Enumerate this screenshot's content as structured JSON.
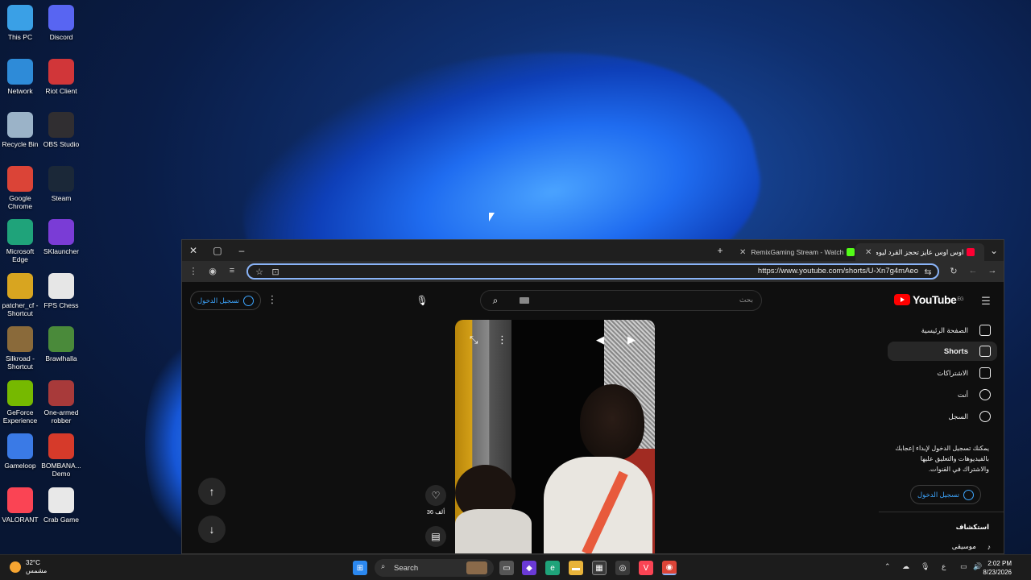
{
  "desktop": {
    "icons": [
      {
        "label": "This PC",
        "icon": "monitor-icon",
        "color": "#3aa0e6"
      },
      {
        "label": "Discord",
        "icon": "discord-icon",
        "color": "#5865f2"
      },
      {
        "label": "Network",
        "icon": "network-icon",
        "color": "#2e8bd8"
      },
      {
        "label": "Riot Client",
        "icon": "riot-icon",
        "color": "#d13639"
      },
      {
        "label": "Recycle Bin",
        "icon": "recycle-bin-icon",
        "color": "#9bb3c8"
      },
      {
        "label": "OBS Studio",
        "icon": "obs-icon",
        "color": "#302e31"
      },
      {
        "label": "Google Chrome",
        "icon": "chrome-icon",
        "color": "#db4437"
      },
      {
        "label": "Steam",
        "icon": "steam-icon",
        "color": "#1b2838"
      },
      {
        "label": "Microsoft Edge",
        "icon": "edge-icon",
        "color": "#1fa37a"
      },
      {
        "label": "SKlauncher",
        "icon": "sklauncher-icon",
        "color": "#7a3cd6"
      },
      {
        "label": "patcher_cf - Shortcut",
        "icon": "patcher-icon",
        "color": "#d8a520"
      },
      {
        "label": "FPS Chess",
        "icon": "chess-icon",
        "color": "#e6e6e6"
      },
      {
        "label": "Silkroad - Shortcut",
        "icon": "silkroad-icon",
        "color": "#8a6a3a"
      },
      {
        "label": "Brawlhalla",
        "icon": "brawlhalla-icon",
        "color": "#4a8a3a"
      },
      {
        "label": "GeForce Experience",
        "icon": "geforce-icon",
        "color": "#76b900"
      },
      {
        "label": "One-armed robber",
        "icon": "robber-icon",
        "color": "#a83a3a"
      },
      {
        "label": "Gameloop",
        "icon": "gameloop-icon",
        "color": "#3a7ae6"
      },
      {
        "label": "BOMBANA... Demo",
        "icon": "bombana-icon",
        "color": "#d63a2a"
      },
      {
        "label": "VALORANT",
        "icon": "valorant-icon",
        "color": "#fa4454"
      },
      {
        "label": "Crab Game",
        "icon": "crab-game-icon",
        "color": "#e8e8e8"
      }
    ]
  },
  "browser": {
    "tabs": [
      {
        "title": "RemixGaming Stream - Watch",
        "favicon_color": "#53fc18"
      },
      {
        "title": "اوس اوس عايز تحجز القرد ليومين",
        "favicon_color": "#ff0033"
      }
    ],
    "url": "https://www.youtube.com/shorts/U-Xn7g4mAeo"
  },
  "youtube": {
    "logo_text": "YouTube",
    "logo_region": "EG",
    "search_placeholder": "بحث",
    "signin_label": "تسجيل الدخول",
    "nav": [
      {
        "label": "الصفحة الرئيسية",
        "icon": "home-icon"
      },
      {
        "label": "Shorts",
        "icon": "shorts-icon"
      },
      {
        "label": "الاشتراكات",
        "icon": "subscriptions-icon"
      },
      {
        "label": "أنت",
        "icon": "you-icon"
      },
      {
        "label": "السجل",
        "icon": "history-icon"
      }
    ],
    "signin_prompt": "يمكنك تسجيل الدخول لإبداء إعجابك بالفيديوهات والتعليق عليها والاشتراك في القنوات.",
    "explore_heading": "استكشاف",
    "explore_music": "موسيقى",
    "like_count": "36 ألف",
    "comment_count": "..."
  },
  "taskbar": {
    "weather_temp": "32°C",
    "weather_desc": "مشمس",
    "search_label": "Search",
    "time": "2:02 PM",
    "date": "8/23/2026",
    "lang": "ع"
  }
}
